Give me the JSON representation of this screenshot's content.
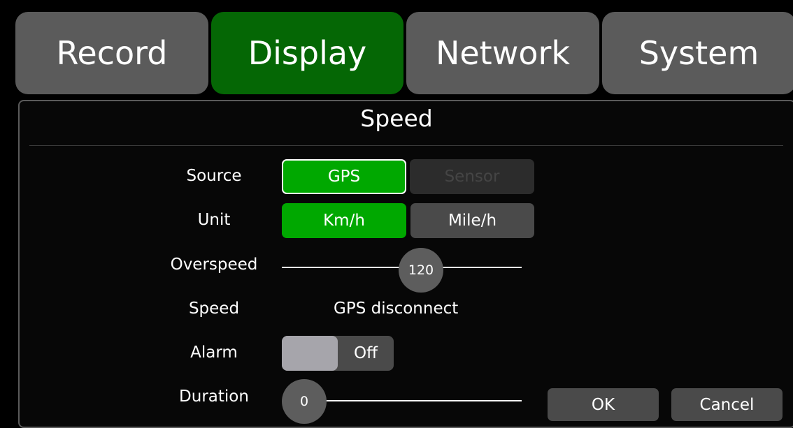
{
  "tabs": {
    "record": "Record",
    "display": "Display",
    "network": "Network",
    "system": "System",
    "active": "Display"
  },
  "dialog": {
    "title": "Speed",
    "source": {
      "label": "Source",
      "options": [
        "GPS",
        "Sensor"
      ],
      "selected": "GPS",
      "disabled": [
        "Sensor"
      ]
    },
    "unit": {
      "label": "Unit",
      "options": [
        "Km/h",
        "Mile/h"
      ],
      "selected": "Km/h"
    },
    "overspeed": {
      "label": "Overspeed",
      "value": "120",
      "position_fraction": 0.6
    },
    "speed": {
      "label": "Speed",
      "value": "GPS disconnect"
    },
    "alarm": {
      "label": "Alarm",
      "state": "Off"
    },
    "duration": {
      "label": "Duration",
      "value": "0",
      "position_fraction": 0
    },
    "ok_label": "OK",
    "cancel_label": "Cancel"
  },
  "colors": {
    "active_tab": "#056705",
    "inactive_tab": "#5b5b5b",
    "selected_button": "#00a800",
    "normal_button": "#4a4a4a",
    "disabled_button": "#2c2c2c"
  }
}
